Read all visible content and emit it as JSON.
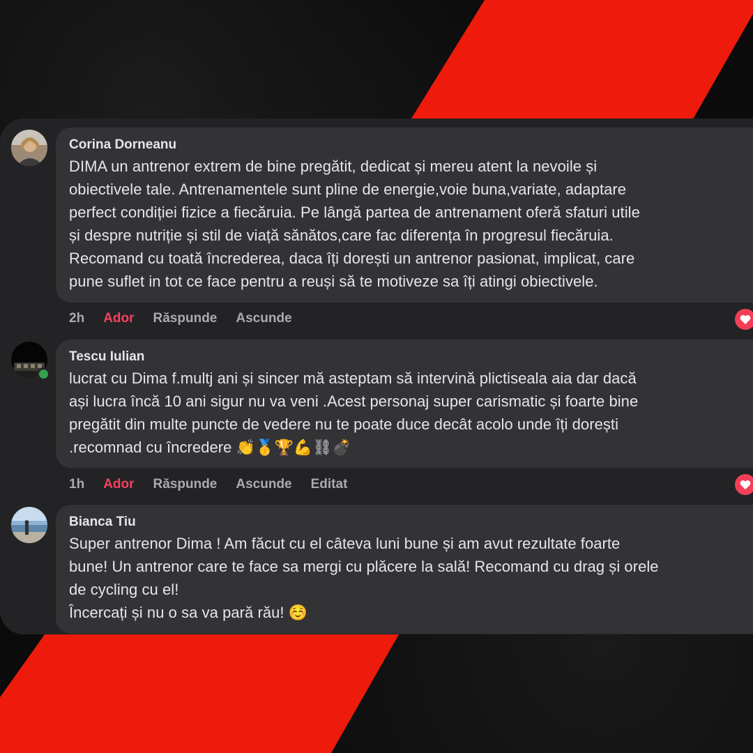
{
  "colors": {
    "stripe": "#ee1a0b",
    "panel": "#232325",
    "bubble": "#333336",
    "text": "#e4e6eb",
    "muted": "#a9abb0",
    "like": "#f3425f",
    "online": "#31a24c"
  },
  "comments": [
    {
      "author": "Corina Dorneanu",
      "text": "DIMA un antrenor extrem de bine pregătit, dedicat și mereu atent la nevoile și\nobiectivele tale. Antrenamentele sunt pline de energie,voie buna,variate, adaptare\nperfect condiției fizice a fiecăruia. Pe lângă partea de antrenament oferă sfaturi utile\nși despre nutriție și stil de viață sănătos,care fac diferența în progresul fiecăruia.\nRecomand cu toată încrederea, daca îți dorești un antrenor pasionat, implicat, care\npune suflet in tot ce face pentru a reuși să te motiveze sa îți atingi obiectivele.",
      "time": "2h",
      "like": "Ador",
      "reply": "Răspunde",
      "hide": "Ascunde",
      "reaction_icon": "heart-icon"
    },
    {
      "author": "Tescu Iulian",
      "text": "lucrat cu Dima f.multj ani și sincer mă asteptam să intervină plictiseala aia dar dacă\nași lucra încă 10 ani sigur nu va veni .Acest personaj super carismatic și foarte bine\npregătit din multe puncte de vedere nu te poate duce decât acolo unde îți dorești\n.recomnad cu încredere 👏🥇🏆💪⛓💣",
      "time": "1h",
      "like": "Ador",
      "reply": "Răspunde",
      "hide": "Ascunde",
      "edited": "Editat",
      "reaction_icon": "heart-icon"
    },
    {
      "author": "Bianca Tiu",
      "text": "Super antrenor Dima ! Am făcut cu el câteva luni bune și am avut rezultate foarte\nbune! Un antrenor care te face sa mergi cu plăcere la sală! Recomand cu drag și orele\nde cycling cu el!\nÎncercați și nu o sa va pară rău! ☺️"
    }
  ]
}
